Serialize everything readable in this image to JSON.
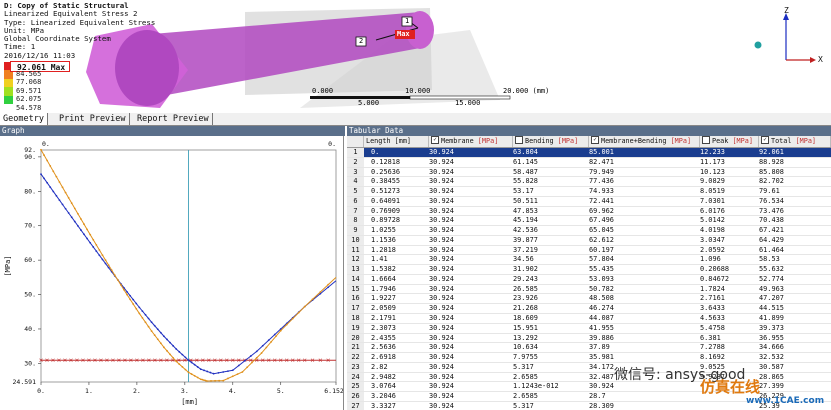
{
  "viewport": {
    "title": "D: Copy of Static Structural",
    "lines": [
      "Linearized Equivalent Stress 2",
      "Type: Linearized Equivalent Stress",
      "Unit: MPa",
      "Global Coordinate System",
      "Time: 1",
      "2016/12/16 11:03"
    ],
    "legend_max": "92.061 Max",
    "legend_values": [
      "84.565",
      "77.068",
      "69.571",
      "62.075",
      "54.578"
    ],
    "legend_colors": [
      "#e02020",
      "#f08020",
      "#f0d020",
      "#a0e020",
      "#30d040"
    ],
    "probe1": "1",
    "probe2": "2",
    "max_label": "Max",
    "ruler_labels": [
      "0.000",
      "10.000",
      "20.000 (mm)",
      "5.000",
      "15.000"
    ],
    "axis_z": "Z",
    "axis_x": "X"
  },
  "tabs": [
    "Geometry",
    "Print Preview",
    "Report Preview"
  ],
  "graph": {
    "title": "Graph",
    "ylabel": "[MPa]",
    "xlabel": "[mm]",
    "y_top": "92.",
    "y_bottom": "24.591",
    "y_ticks": [
      "90.",
      "80.",
      "70.",
      "60.",
      "50.",
      "40.",
      "30."
    ],
    "x_ticks": [
      "0.",
      "1.",
      "2.",
      "3.",
      "4.",
      "5.",
      "6.1528"
    ],
    "top_left_label": "0.",
    "top_right_label": "0."
  },
  "table": {
    "title": "Tabular Data",
    "columns": [
      {
        "label": "Length [mm]",
        "check": false,
        "unit": ""
      },
      {
        "label": "Membrane",
        "check": true,
        "unit": "[MPa]"
      },
      {
        "label": "Bending",
        "check": false,
        "unit": "[MPa]"
      },
      {
        "label": "Membrane+Bending",
        "check": true,
        "unit": "[MPa]"
      },
      {
        "label": "Peak",
        "check": false,
        "unit": "[MPa]"
      },
      {
        "label": "Total",
        "check": true,
        "unit": "[MPa]"
      }
    ],
    "rows": [
      [
        "1",
        "0.",
        "30.924",
        "63.804",
        "85.001",
        "12.233",
        "92.061"
      ],
      [
        "2",
        "0.12818",
        "30.924",
        "61.145",
        "82.471",
        "11.173",
        "88.928"
      ],
      [
        "3",
        "0.25636",
        "30.924",
        "58.487",
        "79.949",
        "10.123",
        "85.808"
      ],
      [
        "4",
        "0.38455",
        "30.924",
        "55.828",
        "77.436",
        "9.0829",
        "82.702"
      ],
      [
        "5",
        "0.51273",
        "30.924",
        "53.17",
        "74.933",
        "8.0519",
        "79.61"
      ],
      [
        "6",
        "0.64091",
        "30.924",
        "50.511",
        "72.441",
        "7.0301",
        "76.534"
      ],
      [
        "7",
        "0.76909",
        "30.924",
        "47.853",
        "69.962",
        "6.0176",
        "73.476"
      ],
      [
        "8",
        "0.89728",
        "30.924",
        "45.194",
        "67.496",
        "5.0142",
        "70.438"
      ],
      [
        "9",
        "1.0255",
        "30.924",
        "42.536",
        "65.045",
        "4.0198",
        "67.421"
      ],
      [
        "10",
        "1.1536",
        "30.924",
        "39.877",
        "62.612",
        "3.0347",
        "64.429"
      ],
      [
        "11",
        "1.2818",
        "30.924",
        "37.219",
        "60.197",
        "2.0592",
        "61.464"
      ],
      [
        "12",
        "1.41",
        "30.924",
        "34.56",
        "57.804",
        "1.096",
        "58.53"
      ],
      [
        "13",
        "1.5382",
        "30.924",
        "31.902",
        "55.435",
        "0.20688",
        "55.632"
      ],
      [
        "14",
        "1.6664",
        "30.924",
        "29.243",
        "53.093",
        "0.84672",
        "52.774"
      ],
      [
        "15",
        "1.7946",
        "30.924",
        "26.585",
        "50.782",
        "1.7824",
        "49.963"
      ],
      [
        "16",
        "1.9227",
        "30.924",
        "23.926",
        "48.508",
        "2.7161",
        "47.207"
      ],
      [
        "17",
        "2.0509",
        "30.924",
        "21.268",
        "46.274",
        "3.6433",
        "44.515"
      ],
      [
        "18",
        "2.1791",
        "30.924",
        "18.609",
        "44.087",
        "4.5633",
        "41.899"
      ],
      [
        "19",
        "2.3073",
        "30.924",
        "15.951",
        "41.955",
        "5.4758",
        "39.373"
      ],
      [
        "20",
        "2.4355",
        "30.924",
        "13.292",
        "39.886",
        "6.381",
        "36.955"
      ],
      [
        "21",
        "2.5636",
        "30.924",
        "10.634",
        "37.89",
        "7.2788",
        "34.666"
      ],
      [
        "22",
        "2.6918",
        "30.924",
        "7.9755",
        "35.981",
        "8.1692",
        "32.532"
      ],
      [
        "23",
        "2.82",
        "30.924",
        "5.317",
        "34.172",
        "9.0525",
        "30.587"
      ],
      [
        "24",
        "2.9482",
        "30.924",
        "2.6585",
        "32.487",
        "9.9287",
        "28.865"
      ],
      [
        "25",
        "3.0764",
        "30.924",
        "1.1243e-012",
        "30.924",
        "",
        "27.399"
      ],
      [
        "26",
        "3.2046",
        "30.924",
        "2.6585",
        "28.7",
        "",
        "26.229"
      ],
      [
        "27",
        "3.3327",
        "30.924",
        "5.317",
        "28.309",
        "",
        "25.39"
      ],
      [
        "28",
        "3.4609",
        "30.924",
        "7.9755",
        "27.297",
        "",
        "24.891"
      ]
    ]
  },
  "watermark": {
    "line1": "微信号: ansys-good",
    "line2": "仿真在线",
    "line3": "www.1CAE.com"
  },
  "chart_data": {
    "type": "line",
    "title": "",
    "xlabel": "[mm]",
    "ylabel": "[MPa]",
    "xlim": [
      0,
      6.1528
    ],
    "ylim": [
      24.591,
      92
    ],
    "grid": false,
    "series": [
      {
        "name": "Membrane",
        "color": "#c03030",
        "marker": "cross",
        "x": [
          0,
          0.5,
          1,
          1.5,
          2,
          2.5,
          3,
          3.5,
          4,
          4.5,
          5,
          5.5,
          6.1528
        ],
        "y": [
          30.924,
          30.924,
          30.924,
          30.924,
          30.924,
          30.924,
          30.924,
          30.924,
          30.924,
          30.924,
          30.924,
          30.924,
          30.924
        ]
      },
      {
        "name": "Membrane+Bending",
        "color": "#2030c0",
        "marker": "dot",
        "x": [
          0,
          0.25636,
          0.51273,
          0.76909,
          1.0255,
          1.2818,
          1.5382,
          1.7946,
          2.0509,
          2.3073,
          2.5636,
          2.82,
          3.0764,
          3.3327,
          3.6,
          4.0,
          4.5,
          5.0,
          5.5,
          6.1528
        ],
        "y": [
          85.001,
          79.949,
          74.933,
          69.962,
          65.045,
          60.197,
          55.435,
          50.782,
          46.274,
          41.955,
          37.89,
          34.172,
          30.924,
          28.309,
          27.0,
          28.0,
          33.5,
          40.0,
          46.5,
          54.0
        ]
      },
      {
        "name": "Total",
        "color": "#e0901a",
        "marker": "dot",
        "x": [
          0,
          0.25636,
          0.51273,
          0.76909,
          1.0255,
          1.2818,
          1.5382,
          1.7946,
          2.0509,
          2.3073,
          2.5636,
          2.82,
          3.0764,
          3.3327,
          3.4609,
          3.8,
          4.2,
          4.6,
          5.0,
          5.5,
          6.1528
        ],
        "y": [
          92.061,
          85.808,
          79.61,
          73.476,
          67.421,
          61.464,
          55.632,
          49.963,
          44.515,
          39.373,
          34.666,
          30.587,
          27.399,
          25.39,
          24.891,
          25.0,
          27.5,
          33.0,
          39.5,
          46.5,
          55.0
        ]
      }
    ],
    "cursor_x": 3.0764
  }
}
